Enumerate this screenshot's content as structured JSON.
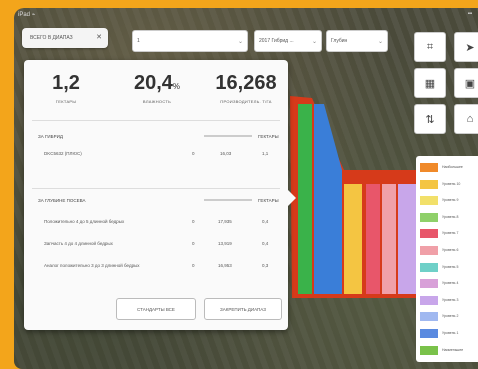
{
  "statusbar": {
    "left": "iPad ⌁",
    "right": "▪▪"
  },
  "panel": {
    "tab_label": "ВСЕГО В ДИАПАЗ",
    "stats": [
      {
        "value": "1,2",
        "unit": "",
        "label": "ГЕКТАРЫ"
      },
      {
        "value": "20,4",
        "unit": "%",
        "label": "ВЛАЖНОСТЬ"
      },
      {
        "value": "16,268",
        "unit": "",
        "label": "ПРОИЗВОДИТЕЛЬ. Т/ГА"
      }
    ],
    "section1": {
      "title": "ЗА ГИБРИД",
      "right": "ГЕКТАРЫ"
    },
    "section1_rows": [
      {
        "name": "DKC5632 (ПЛЮС)",
        "c1": "0",
        "c2": "16,03",
        "c3": "1,1"
      }
    ],
    "section2": {
      "title": "ЗА ГЛУБИНЕ ПОСЕВА",
      "right": "ГЕКТАРЫ"
    },
    "section2_rows": [
      {
        "name": "Положительно 4 до 5 длинной бедрых",
        "c1": "0",
        "c2": "17,935",
        "c3": "0,4"
      },
      {
        "name": "Запчасть 4 до 4 длинной бедрых",
        "c1": "0",
        "c2": "13,919",
        "c3": "0,4"
      },
      {
        "name": "Аналог положительно 3 до 3 длинной бедрых",
        "c1": "0",
        "c2": "16,953",
        "c3": "0,3"
      }
    ],
    "btn_left": "СТАНДАРТЫ ВСЕ",
    "btn_right": "ЗАКРЕПИТЬ ДИАПАЗ"
  },
  "selects": [
    {
      "value": "1",
      "chev": "⌄"
    },
    {
      "value": "2017 Гибрид ...",
      "chev": "⌄"
    },
    {
      "value": "Глубин",
      "chev": "⌄"
    }
  ],
  "toolbar_icons": [
    "focus-icon",
    "navigate-icon",
    "grid-icon",
    "calendar-icon",
    "layers-icon",
    "home-icon"
  ],
  "toolbar_glyphs": [
    "⌗",
    "➤",
    "▦",
    "▣",
    "⇅",
    "⌂"
  ],
  "legend": [
    {
      "label": "Наибольшее",
      "color": "#f08a2a"
    },
    {
      "label": "Уровень 10",
      "color": "#f4c542"
    },
    {
      "label": "Уровень 9",
      "color": "#f2e06a"
    },
    {
      "label": "Уровень 8",
      "color": "#8fd06a"
    },
    {
      "label": "Уровень 7",
      "color": "#e8566a"
    },
    {
      "label": "Уровень 6",
      "color": "#f0a0a8"
    },
    {
      "label": "Уровень 5",
      "color": "#6fd0c8"
    },
    {
      "label": "Уровень 4",
      "color": "#d8a0d8"
    },
    {
      "label": "Уровень 3",
      "color": "#c8a6ea"
    },
    {
      "label": "Уровень 2",
      "color": "#a0b8f0"
    },
    {
      "label": "Уровень 1",
      "color": "#5a8ae0"
    },
    {
      "label": "Наименьшее",
      "color": "#7ac24a"
    }
  ],
  "field_colors": [
    "#3a7ed8",
    "#3ab24a",
    "#e8566a",
    "#f08a2a",
    "#f4c542"
  ]
}
